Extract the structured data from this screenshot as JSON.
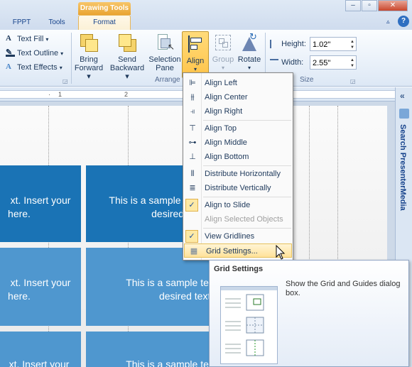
{
  "tabs": {
    "fppt": "FPPT",
    "tools": "Tools",
    "contextual_header": "Drawing Tools",
    "format": "Format"
  },
  "window": {
    "min": "–",
    "max": "▫",
    "close": "✕",
    "ribbon_min": "▵",
    "help": "?"
  },
  "ribbon": {
    "text_fill": "Text Fill",
    "text_outline": "Text Outline",
    "text_effects": "Text Effects",
    "bring_forward": [
      "Bring",
      "Forward ▾"
    ],
    "send_backward": [
      "Send",
      "Backward ▾"
    ],
    "selection_pane": [
      "Selection",
      "Pane"
    ],
    "align": [
      "Align",
      "▾"
    ],
    "group": [
      "Group",
      "▾"
    ],
    "rotate": [
      "Rotate",
      "▾"
    ],
    "arrange_label": "Arrange",
    "size_label": "Size",
    "height_label": "Height:",
    "height_value": "1.02\"",
    "width_label": "Width:",
    "width_value": "2.55\""
  },
  "ruler": {
    "ticks": [
      "1",
      "2"
    ]
  },
  "sidepane": {
    "title": "Search PresenterMedia",
    "close": "«"
  },
  "slide": {
    "cell_text_left_1": "xt. Insert your",
    "cell_text_left_2": "here.",
    "cell_text_right_1": "This is a sample",
    "cell_text_right_1b": "This is a sample text",
    "cell_text_right_2": "desired t",
    "cell_text_right_2b": "desired text h"
  },
  "menu": {
    "items": [
      {
        "label": "Align Left",
        "icon": "align-left-icon"
      },
      {
        "label": "Align Center",
        "icon": "align-center-icon"
      },
      {
        "label": "Align Right",
        "icon": "align-right-icon"
      },
      {
        "label": "Align Top",
        "icon": "align-top-icon"
      },
      {
        "label": "Align Middle",
        "icon": "align-middle-icon"
      },
      {
        "label": "Align Bottom",
        "icon": "align-bottom-icon"
      },
      {
        "label": "Distribute Horizontally",
        "icon": "distribute-horizontally-icon"
      },
      {
        "label": "Distribute Vertically",
        "icon": "distribute-vertically-icon"
      },
      {
        "label": "Align to Slide",
        "checked": true
      },
      {
        "label": "Align Selected Objects",
        "disabled": true
      },
      {
        "label": "View Gridlines",
        "checked": true
      },
      {
        "label": "Grid Settings...",
        "icon": "grid-icon",
        "hover": true
      }
    ]
  },
  "tooltip": {
    "title": "Grid Settings",
    "description": "Show the Grid and Guides dialog box."
  },
  "colors": {
    "cell_dark": "#1a73b5",
    "cell_light": "#4f97cf",
    "accent": "#e9a330"
  }
}
